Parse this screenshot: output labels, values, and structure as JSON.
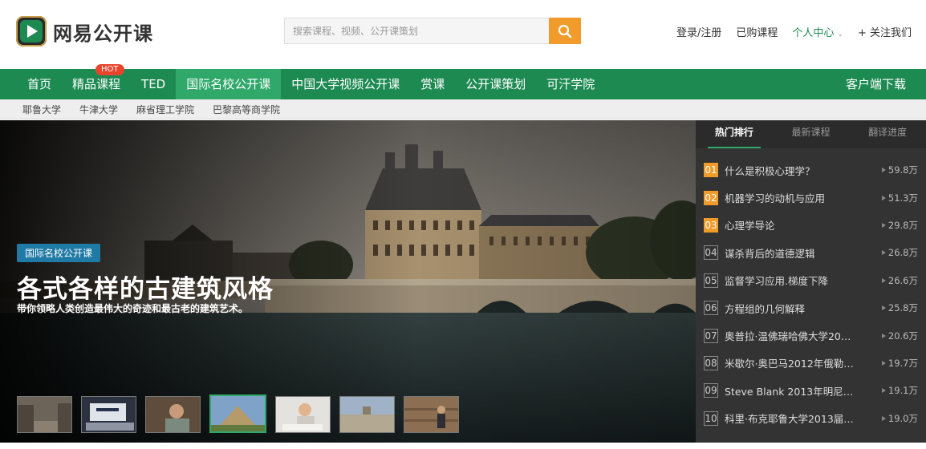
{
  "brand": {
    "name": "网易公开课"
  },
  "search": {
    "placeholder": "搜索课程、视频、公开课策划"
  },
  "top_links": {
    "login": "登录/注册",
    "purchased": "已购课程",
    "user_center": "个人中心",
    "follow": "+ 关注我们"
  },
  "nav": {
    "items": [
      {
        "label": "首页"
      },
      {
        "label": "精品课程",
        "badge": "HOT"
      },
      {
        "label": "TED"
      },
      {
        "label": "国际名校公开课",
        "active": true
      },
      {
        "label": "中国大学视频公开课"
      },
      {
        "label": "赏课"
      },
      {
        "label": "公开课策划"
      },
      {
        "label": "可汗学院"
      }
    ],
    "download": "客户端下载"
  },
  "subnav": {
    "items": [
      "耶鲁大学",
      "牛津大学",
      "麻省理工学院",
      "巴黎高等商学院"
    ]
  },
  "banner": {
    "tag": "国际名校公开课",
    "headline": "各式各样的古建筑风格",
    "subline": "带你领略人类创造最伟大的奇迹和最古老的建筑艺术。",
    "active_thumb_index": 3
  },
  "rank": {
    "tabs": [
      "热门排行",
      "最新课程",
      "翻译进度"
    ],
    "active_tab": 0,
    "items": [
      {
        "num": "01",
        "title": "什么是积极心理学？",
        "views": "59.8万"
      },
      {
        "num": "02",
        "title": "机器学习的动机与应用",
        "views": "51.3万"
      },
      {
        "num": "03",
        "title": "心理学导论",
        "views": "29.8万"
      },
      {
        "num": "04",
        "title": "谋杀背后的道德逻辑",
        "views": "26.8万"
      },
      {
        "num": "05",
        "title": "监督学习应用.梯度下降",
        "views": "26.6万"
      },
      {
        "num": "06",
        "title": "方程组的几何解释",
        "views": "25.8万"
      },
      {
        "num": "07",
        "title": "奥普拉·温佛瑞哈佛大学20…",
        "views": "20.6万"
      },
      {
        "num": "08",
        "title": "米歇尔·奥巴马2012年俄勒…",
        "views": "19.7万"
      },
      {
        "num": "09",
        "title": "Steve Blank 2013年明尼苏…",
        "views": "19.1万"
      },
      {
        "num": "10",
        "title": "科里·布克耶鲁大学2013届…",
        "views": "19.0万"
      }
    ]
  },
  "colors": {
    "brand_green": "#1d8a52",
    "active_green": "#2fa86a",
    "accent_orange": "#f09b2a",
    "hot_red": "#e8452e",
    "tag_blue": "#1f7aa5"
  }
}
